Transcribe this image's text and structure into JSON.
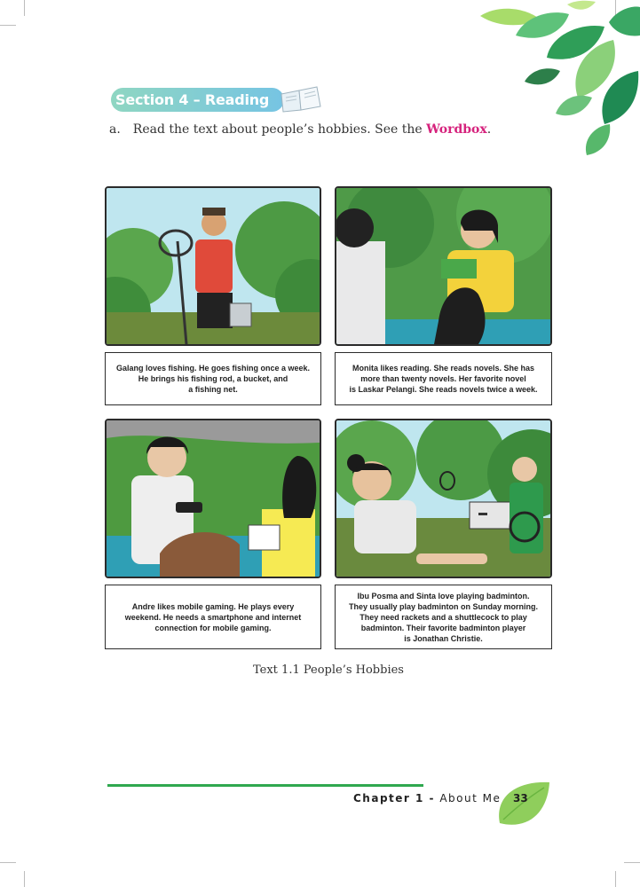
{
  "section": {
    "title": "Section 4 – Reading"
  },
  "instruction": {
    "marker": "a.",
    "text_before": "Read the text about people’s hobbies. See the ",
    "highlight": "Wordbox",
    "text_after": "."
  },
  "panels": [
    {
      "caption_lines": [
        "Galang loves fishing. He goes fishing once a week.",
        "He brings his fishing rod, a bucket, and",
        "a fishing net."
      ]
    },
    {
      "caption_lines": [
        "Monita likes reading. She reads novels. She has",
        "more than twenty novels. Her favorite novel",
        "is Laskar Pelangi. She reads novels twice a week."
      ]
    },
    {
      "caption_lines": [
        "Andre likes mobile gaming. He plays every",
        "weekend. He needs a smartphone and internet",
        "connection for mobile gaming."
      ]
    },
    {
      "caption_lines": [
        "Ibu Posma and Sinta love playing badminton.",
        "They usually play badminton on Sunday morning.",
        "They need rackets and a shuttlecock to play",
        "badminton. Their favorite badminton player",
        "is Jonathan Christie."
      ]
    }
  ],
  "figure_caption": "Text 1.1 People’s Hobbies",
  "footer": {
    "chapter_label": "Chapter 1 -",
    "chapter_title": "About Me",
    "page_number": "33"
  },
  "colors": {
    "accent_green": "#2fa84f",
    "wordbox_pink": "#d6237d",
    "pill_start": "#8fd6c2",
    "pill_end": "#76c4e3"
  },
  "icons": [
    "open-book-icon",
    "leaf-decoration",
    "page-number-leaf-icon"
  ]
}
